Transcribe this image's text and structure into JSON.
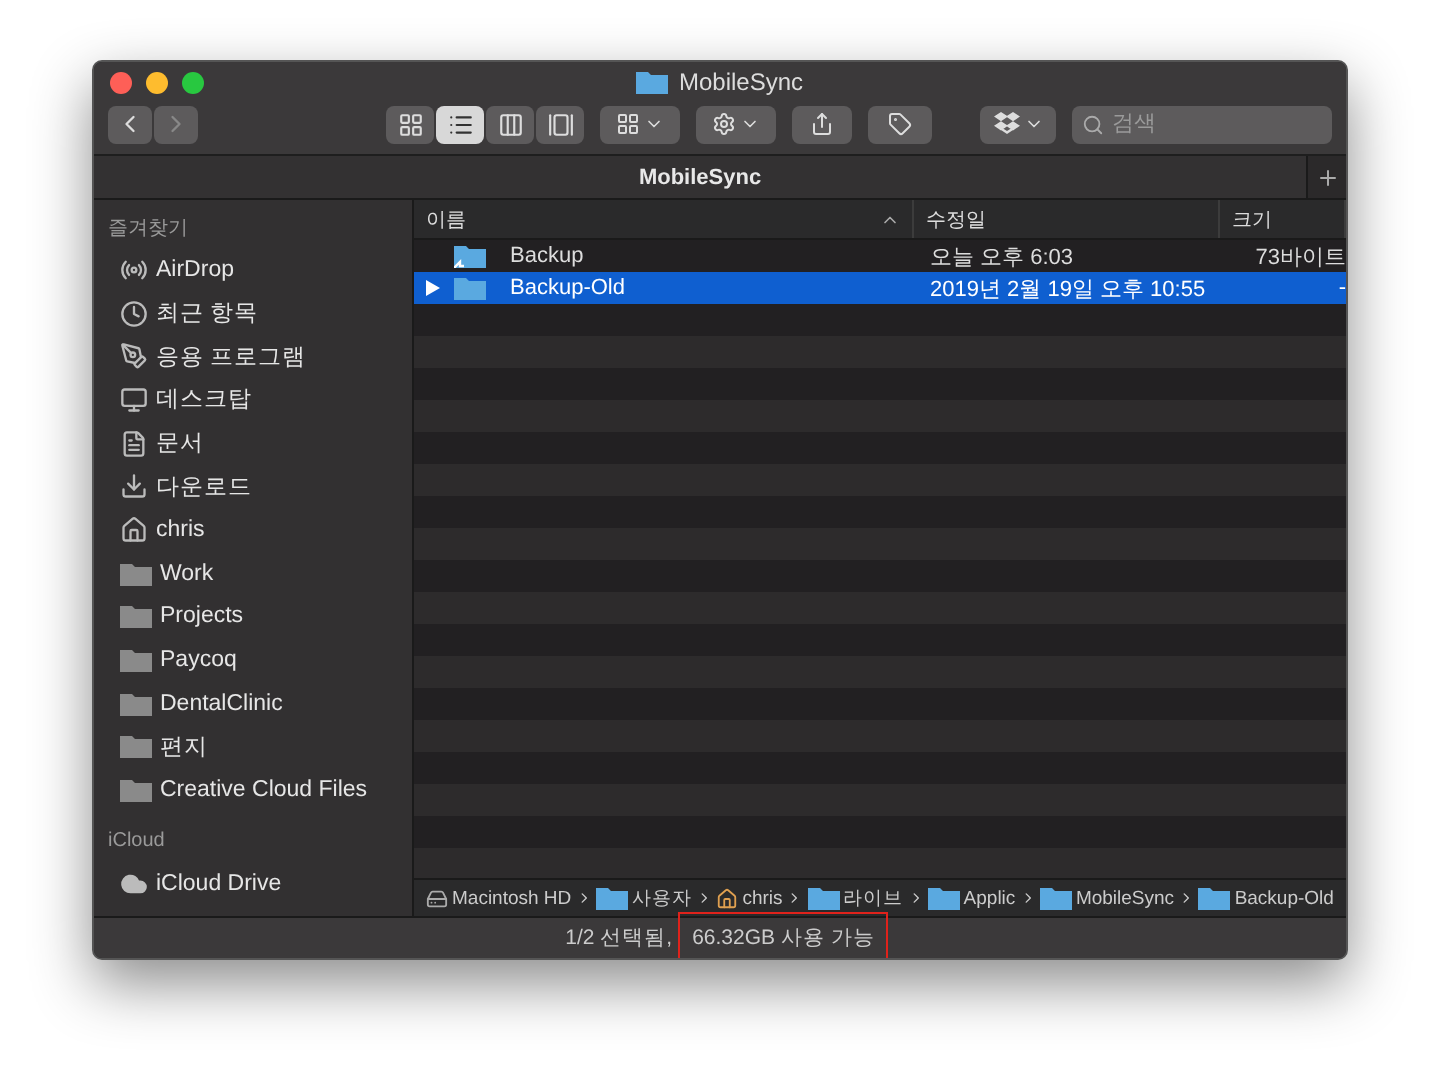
{
  "window": {
    "title": "MobileSync"
  },
  "toolbar": {
    "view_modes": [
      {
        "kind": "icons",
        "selected": false
      },
      {
        "kind": "list",
        "selected": true
      },
      {
        "kind": "columns",
        "selected": false
      },
      {
        "kind": "gallery",
        "selected": false
      }
    ],
    "search": {
      "placeholder": "검색"
    }
  },
  "tab": {
    "title": "MobileSync"
  },
  "sidebar": {
    "sections": [
      {
        "title": "즐겨찾기",
        "items": [
          {
            "label": "AirDrop",
            "kind": "airdrop"
          },
          {
            "label": "최근 항목",
            "kind": "recent"
          },
          {
            "label": "응용 프로그램",
            "kind": "apps"
          },
          {
            "label": "데스크탑",
            "kind": "desktop"
          },
          {
            "label": "문서",
            "kind": "documents"
          },
          {
            "label": "다운로드",
            "kind": "downloads"
          },
          {
            "label": "chris",
            "kind": "home"
          },
          {
            "label": "Work",
            "kind": "folder"
          },
          {
            "label": "Projects",
            "kind": "folder"
          },
          {
            "label": "Paycoq",
            "kind": "folder"
          },
          {
            "label": "DentalClinic",
            "kind": "folder"
          },
          {
            "label": "편지",
            "kind": "folder"
          },
          {
            "label": "Creative Cloud Files",
            "kind": "folder"
          }
        ]
      },
      {
        "title": "iCloud",
        "items": [
          {
            "label": "iCloud Drive",
            "kind": "cloud"
          }
        ]
      }
    ]
  },
  "table": {
    "columns": [
      {
        "label": "이름",
        "sorted": true
      },
      {
        "label": "수정일",
        "sorted": false
      },
      {
        "label": "크기",
        "sorted": false
      }
    ],
    "rows": [
      {
        "name": "Backup",
        "modified": "오늘 오후 6:03",
        "size": "73바이트",
        "selected": false,
        "expandable": false,
        "kind": "alias"
      },
      {
        "name": "Backup-Old",
        "modified": "2019년 2월 19일 오후 10:55",
        "size": "-",
        "selected": true,
        "expandable": true,
        "kind": "folder"
      }
    ]
  },
  "path_bar": [
    {
      "label": "Macintosh HD",
      "kind": "disk"
    },
    {
      "label": "사용자",
      "kind": "users"
    },
    {
      "label": "chris",
      "kind": "home"
    },
    {
      "label": "라이브",
      "kind": "folder"
    },
    {
      "label": "Applic",
      "kind": "folder"
    },
    {
      "label": "MobileSync",
      "kind": "folder"
    },
    {
      "label": "Backup-Old",
      "kind": "folder"
    }
  ],
  "status_bar": {
    "parts": [
      {
        "text": "1/2 선택됨,",
        "highlighted": false
      },
      {
        "text": "66.32GB 사용 가능",
        "highlighted": true
      }
    ]
  }
}
